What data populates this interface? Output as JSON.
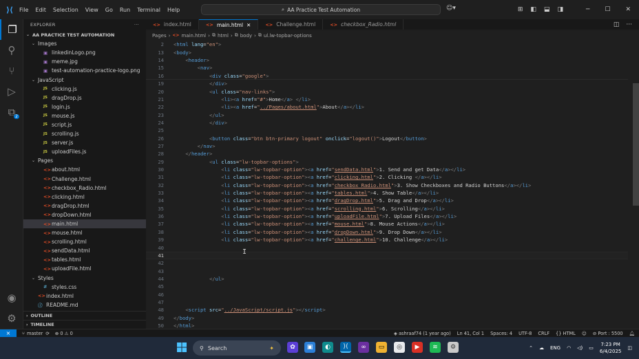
{
  "titlebar": {
    "menu": [
      "File",
      "Edit",
      "Selection",
      "View",
      "Go",
      "Run",
      "Terminal",
      "Help"
    ],
    "command_center": "AA Practice Test Automation"
  },
  "explorer": {
    "title": "EXPLORER",
    "root": "AA PRACTICE TEST AUTOMATION",
    "images_folder": "Images",
    "images": [
      "linkedinLogo.png",
      "meme.jpg",
      "test-automation-practice-logo.png"
    ],
    "js_folder": "JavaScript",
    "js_files": [
      "clicking.js",
      "dragDrop.js",
      "login.js",
      "mouse.js",
      "script.js",
      "scrolling.js",
      "server.js",
      "uploadFiles.js"
    ],
    "pages_folder": "Pages",
    "pages": [
      "about.html",
      "Challenge.html",
      "checkbox_Radio.html",
      "clicking.html",
      "dragDrop.html",
      "dropDown.html",
      "main.html",
      "mouse.html",
      "scrolling.html",
      "sendData.html",
      "tables.html",
      "uploadFile.html"
    ],
    "selected_page": "main.html",
    "styles_folder": "Styles",
    "styles": [
      "styles.css"
    ],
    "root_files": [
      "index.html",
      "README.md"
    ],
    "outline": "OUTLINE",
    "timeline": "TIMELINE"
  },
  "tabs": [
    {
      "label": "index.html",
      "active": false,
      "italic": false
    },
    {
      "label": "main.html",
      "active": true,
      "italic": false
    },
    {
      "label": "Challenge.html",
      "active": false,
      "italic": false
    },
    {
      "label": "checkbox_Radio.html",
      "active": false,
      "italic": true
    }
  ],
  "breadcrumb": [
    "Pages",
    "main.html",
    "html",
    "body",
    "ul.lw-topbar-options"
  ],
  "editor": {
    "sticky_lines": [
      {
        "n": "2",
        "html": "<span class=\"p\">&lt;</span><span class=\"t\">html</span> <span class=\"a\">lang</span>=<span class=\"s\">\"en\"</span><span class=\"p\">&gt;</span>"
      },
      {
        "n": "13",
        "html": "<span class=\"p\">&lt;</span><span class=\"t\">body</span><span class=\"p\">&gt;</span>"
      },
      {
        "n": "14",
        "html": "    <span class=\"p\">&lt;</span><span class=\"t\">header</span><span class=\"p\">&gt;</span>"
      },
      {
        "n": "15",
        "html": "        <span class=\"p\">&lt;</span><span class=\"t\">nav</span><span class=\"p\">&gt;</span>"
      },
      {
        "n": "16",
        "html": "            <span class=\"p\">&lt;</span><span class=\"t\">div</span> <span class=\"a\">class</span>=<span class=\"s\">\"google\"</span><span class=\"p\">&gt;</span>"
      }
    ],
    "lines": [
      {
        "n": "19",
        "html": "            <span class=\"p\">&lt;/</span><span class=\"t\">div</span><span class=\"p\">&gt;</span>"
      },
      {
        "n": "20",
        "html": "            <span class=\"p\">&lt;</span><span class=\"t\">ul</span> <span class=\"a\">class</span>=<span class=\"s\">\"nav-links\"</span><span class=\"p\">&gt;</span>"
      },
      {
        "n": "21",
        "html": "                <span class=\"p\">&lt;</span><span class=\"t\">li</span><span class=\"p\">&gt;&lt;</span><span class=\"t\">a</span> <span class=\"a\">href</span>=<span class=\"s\">\"#\"</span><span class=\"p\">&gt;</span>Home<span class=\"p\">&lt;/</span><span class=\"t\">a</span><span class=\"p\">&gt;</span> <span class=\"p\">&lt;/</span><span class=\"t\">li</span><span class=\"p\">&gt;</span>"
      },
      {
        "n": "22",
        "html": "                <span class=\"p\">&lt;</span><span class=\"t\">li</span><span class=\"p\">&gt;&lt;</span><span class=\"t\">a</span> <span class=\"a\">href</span>=<span class=\"s\">\"<span class=\"sx\">../Pages/about.html</span>\"</span><span class=\"p\">&gt;</span>About<span class=\"p\">&lt;/</span><span class=\"t\">a</span><span class=\"p\">&gt;&lt;/</span><span class=\"t\">li</span><span class=\"p\">&gt;</span>"
      },
      {
        "n": "23",
        "html": "            <span class=\"p\">&lt;/</span><span class=\"t\">ul</span><span class=\"p\">&gt;</span>"
      },
      {
        "n": "24",
        "html": "            <span class=\"p\">&lt;/</span><span class=\"t\">div</span><span class=\"p\">&gt;</span>"
      },
      {
        "n": "25",
        "html": ""
      },
      {
        "n": "26",
        "html": "            <span class=\"p\">&lt;</span><span class=\"t\">button</span> <span class=\"a\">class</span>=<span class=\"s\">\"btn btn-primary logout\"</span> <span class=\"a\">onclick</span>=<span class=\"s\">\"logout()\"</span><span class=\"p\">&gt;</span>Logout<span class=\"p\">&lt;/</span><span class=\"t\">button</span><span class=\"p\">&gt;</span>"
      },
      {
        "n": "27",
        "html": "        <span class=\"p\">&lt;/</span><span class=\"t\">nav</span><span class=\"p\">&gt;</span>"
      },
      {
        "n": "28",
        "html": "    <span class=\"p\">&lt;/</span><span class=\"t\">header</span><span class=\"p\">&gt;</span>"
      },
      {
        "n": "29",
        "html": "            <span class=\"p\">&lt;</span><span class=\"t\">ul</span> <span class=\"a\">class</span>=<span class=\"s\">\"lw-topbar-options\"</span><span class=\"p\">&gt;</span>"
      },
      {
        "n": "30",
        "html": "                <span class=\"p\">&lt;</span><span class=\"t\">li</span> <span class=\"a\">class</span>=<span class=\"s\">\"lw-topbar-option\"</span><span class=\"p\">&gt;&lt;</span><span class=\"t\">a</span> <span class=\"a\">href</span>=<span class=\"s\">\"<span class=\"sx\">sendData.html</span>\"</span><span class=\"p\">&gt;</span>1. Send and get Data<span class=\"p\">&lt;/</span><span class=\"t\">a</span><span class=\"p\">&gt;&lt;/</span><span class=\"t\">li</span><span class=\"p\">&gt;</span>"
      },
      {
        "n": "31",
        "html": "                <span class=\"p\">&lt;</span><span class=\"t\">li</span> <span class=\"a\">class</span>=<span class=\"s\">\"lw-topbar-option\"</span><span class=\"p\">&gt;&lt;</span><span class=\"t\">a</span> <span class=\"a\">href</span>=<span class=\"s\">\"<span class=\"sx\">clicking.html</span>\"</span><span class=\"p\">&gt;</span>2. Clicking <span class=\"p\">&lt;/</span><span class=\"t\">a</span><span class=\"p\">&gt;&lt;/</span><span class=\"t\">li</span><span class=\"p\">&gt;</span>"
      },
      {
        "n": "32",
        "html": "                <span class=\"p\">&lt;</span><span class=\"t\">li</span> <span class=\"a\">class</span>=<span class=\"s\">\"lw-topbar-option\"</span><span class=\"p\">&gt;&lt;</span><span class=\"t\">a</span> <span class=\"a\">href</span>=<span class=\"s\">\"<span class=\"sx\">checkbox_Radio.html</span>\"</span><span class=\"p\">&gt;</span>3. Show Checkboxes and Radio Buttons<span class=\"p\">&lt;/</span><span class=\"t\">a</span><span class=\"p\">&gt;&lt;/</span><span class=\"t\">li</span><span class=\"p\">&gt;</span>"
      },
      {
        "n": "33",
        "html": "                <span class=\"p\">&lt;</span><span class=\"t\">li</span> <span class=\"a\">class</span>=<span class=\"s\">\"lw-topbar-option\"</span><span class=\"p\">&gt;&lt;</span><span class=\"t\">a</span> <span class=\"a\">href</span>=<span class=\"s\">\"<span class=\"sx\">tables.html</span>\"</span><span class=\"p\">&gt;</span>4. Show Table<span class=\"p\">&lt;/</span><span class=\"t\">a</span><span class=\"p\">&gt;&lt;/</span><span class=\"t\">li</span><span class=\"p\">&gt;</span>"
      },
      {
        "n": "34",
        "html": "                <span class=\"p\">&lt;</span><span class=\"t\">li</span> <span class=\"a\">class</span>=<span class=\"s\">\"lw-topbar-option\"</span><span class=\"p\">&gt;&lt;</span><span class=\"t\">a</span> <span class=\"a\">href</span>=<span class=\"s\">\"<span class=\"sx\">dragDrop.html</span>\"</span><span class=\"p\">&gt;</span>5. Drag and Drop<span class=\"p\">&lt;/</span><span class=\"t\">a</span><span class=\"p\">&gt;&lt;/</span><span class=\"t\">li</span><span class=\"p\">&gt;</span>"
      },
      {
        "n": "35",
        "html": "                <span class=\"p\">&lt;</span><span class=\"t\">li</span> <span class=\"a\">class</span>=<span class=\"s\">\"lw-topbar-option\"</span><span class=\"p\">&gt;&lt;</span><span class=\"t\">a</span> <span class=\"a\">href</span>=<span class=\"s\">\"<span class=\"sx\">scrolling.html</span>\"</span><span class=\"p\">&gt;</span>6. Scrolling<span class=\"p\">&lt;/</span><span class=\"t\">a</span><span class=\"p\">&gt;&lt;/</span><span class=\"t\">li</span><span class=\"p\">&gt;</span>"
      },
      {
        "n": "36",
        "html": "                <span class=\"p\">&lt;</span><span class=\"t\">li</span> <span class=\"a\">class</span>=<span class=\"s\">\"lw-topbar-option\"</span><span class=\"p\">&gt;&lt;</span><span class=\"t\">a</span> <span class=\"a\">href</span>=<span class=\"s\">\"<span class=\"sx\">uploadFile.html</span>\"</span><span class=\"p\">&gt;</span>7. Upload Files<span class=\"p\">&lt;/</span><span class=\"t\">a</span><span class=\"p\">&gt;&lt;/</span><span class=\"t\">li</span><span class=\"p\">&gt;</span>"
      },
      {
        "n": "37",
        "html": "                <span class=\"p\">&lt;</span><span class=\"t\">li</span> <span class=\"a\">class</span>=<span class=\"s\">\"lw-topbar-option\"</span><span class=\"p\">&gt;&lt;</span><span class=\"t\">a</span> <span class=\"a\">href</span>=<span class=\"s\">\"<span class=\"sx\">mouse.html</span>\"</span><span class=\"p\">&gt;</span>8. Mouse Actions<span class=\"p\">&lt;/</span><span class=\"t\">a</span><span class=\"p\">&gt;&lt;/</span><span class=\"t\">li</span><span class=\"p\">&gt;</span>"
      },
      {
        "n": "38",
        "html": "                <span class=\"p\">&lt;</span><span class=\"t\">li</span> <span class=\"a\">class</span>=<span class=\"s\">\"lw-topbar-option\"</span><span class=\"p\">&gt;&lt;</span><span class=\"t\">a</span> <span class=\"a\">href</span>=<span class=\"s\">\"<span class=\"sx\">dropDown.html</span>\"</span><span class=\"p\">&gt;</span>9. Drop Down<span class=\"p\">&lt;/</span><span class=\"t\">a</span><span class=\"p\">&gt;&lt;/</span><span class=\"t\">li</span><span class=\"p\">&gt;</span>"
      },
      {
        "n": "39",
        "html": "                <span class=\"p\">&lt;</span><span class=\"t\">li</span> <span class=\"a\">class</span>=<span class=\"s\">\"lw-topbar-option\"</span><span class=\"p\">&gt;&lt;</span><span class=\"t\">a</span> <span class=\"a\">href</span>=<span class=\"s\">\"<span class=\"sx\">challenge.html</span>\"</span><span class=\"p\">&gt;</span>10. Challenge<span class=\"p\">&lt;/</span><span class=\"t\">a</span><span class=\"p\">&gt;&lt;/</span><span class=\"t\">li</span><span class=\"p\">&gt;</span>"
      },
      {
        "n": "40",
        "html": ""
      },
      {
        "n": "41",
        "html": "",
        "current": true
      },
      {
        "n": "42",
        "html": ""
      },
      {
        "n": "43",
        "html": ""
      },
      {
        "n": "44",
        "html": "            <span class=\"p\">&lt;/</span><span class=\"t\">ul</span><span class=\"p\">&gt;</span>"
      },
      {
        "n": "45",
        "html": ""
      },
      {
        "n": "46",
        "html": ""
      },
      {
        "n": "47",
        "html": ""
      },
      {
        "n": "48",
        "html": "    <span class=\"p\">&lt;</span><span class=\"t\">script</span> <span class=\"a\">src</span>=<span class=\"s\">\"<span class=\"sx\">../JavaScript/script.js</span>\"</span><span class=\"p\">&gt;&lt;/</span><span class=\"t\">script</span><span class=\"p\">&gt;</span>"
      },
      {
        "n": "49",
        "html": "<span class=\"p\">&lt;/</span><span class=\"t\">body</span><span class=\"p\">&gt;</span>"
      },
      {
        "n": "50",
        "html": "<span class=\"p\">&lt;/</span><span class=\"t\">html</span><span class=\"p\">&gt;</span>"
      }
    ]
  },
  "statusbar": {
    "branch": "master",
    "sync_icon": "sync-icon",
    "problems": "⊗ 0 ⚠ 0",
    "blame": "ashraaf74 (1 year ago)",
    "cursor": "Ln 41, Col 1",
    "spaces": "Spaces: 4",
    "encoding": "UTF-8",
    "eol": "CRLF",
    "language": "HTML",
    "port": "Port : 5500"
  },
  "taskbar": {
    "search_placeholder": "Search",
    "language": "ENG",
    "time": "7:23 PM",
    "date": "6/4/2025"
  },
  "colors": {
    "accent": "#0078d4",
    "editor_bg": "#1f1f1f",
    "sidebar_bg": "#181818",
    "taskbar_bg": "#202a3a"
  }
}
